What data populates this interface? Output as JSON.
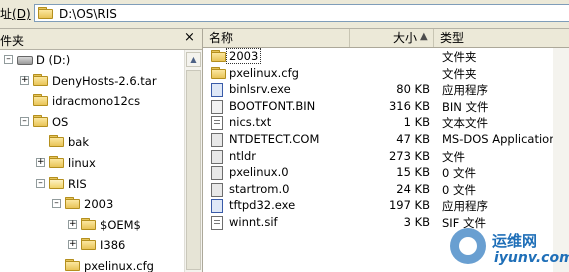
{
  "address": {
    "label_prefix": "址",
    "label_key": "(D)",
    "path": "D:\\OS\\RIS"
  },
  "folders_panel": {
    "title": "件夹",
    "close": "×",
    "tree": [
      {
        "label": "D (D:)",
        "kind": "drive",
        "expander": "−"
      },
      {
        "label": "DenyHosts-2.6.tar",
        "kind": "folder",
        "expander": "+"
      },
      {
        "label": "idracmono12cs",
        "kind": "folder",
        "expander": ""
      },
      {
        "label": "OS",
        "kind": "folder",
        "expander": "−"
      },
      {
        "label": "bak",
        "kind": "folder",
        "expander": ""
      },
      {
        "label": "linux",
        "kind": "folder",
        "expander": "+"
      },
      {
        "label": "RIS",
        "kind": "folder-open",
        "expander": "−"
      },
      {
        "label": "2003",
        "kind": "folder",
        "expander": "−"
      },
      {
        "label": "$OEM$",
        "kind": "folder",
        "expander": "+"
      },
      {
        "label": "I386",
        "kind": "folder",
        "expander": "+"
      },
      {
        "label": "pxelinux.cfg",
        "kind": "folder",
        "expander": ""
      }
    ]
  },
  "columns": {
    "name": "名称",
    "size": "大小",
    "type": "类型",
    "sort_arrow": "▲"
  },
  "files": [
    {
      "name": "2003",
      "size": "",
      "type": "文件夹",
      "icon": "folder-icon",
      "selected": true
    },
    {
      "name": "pxelinux.cfg",
      "size": "",
      "type": "文件夹",
      "icon": "folder-icon"
    },
    {
      "name": "binlsrv.exe",
      "size": "80 KB",
      "type": "应用程序",
      "icon": "exe-icon"
    },
    {
      "name": "BOOTFONT.BIN",
      "size": "316 KB",
      "type": "BIN 文件",
      "icon": "bin-file-icon"
    },
    {
      "name": "nics.txt",
      "size": "1 KB",
      "type": "文本文件",
      "icon": "text-file-icon"
    },
    {
      "name": "NTDETECT.COM",
      "size": "47 KB",
      "type": "MS-DOS Application",
      "icon": "com-file-icon"
    },
    {
      "name": "ntldr",
      "size": "273 KB",
      "type": "文件",
      "icon": "system-file-icon"
    },
    {
      "name": "pxelinux.0",
      "size": "15 KB",
      "type": "0 文件",
      "icon": "system-file-icon"
    },
    {
      "name": "startrom.0",
      "size": "24 KB",
      "type": "0 文件",
      "icon": "system-file-icon"
    },
    {
      "name": "tftpd32.exe",
      "size": "197 KB",
      "type": "应用程序",
      "icon": "tftpd-exe-icon"
    },
    {
      "name": "winnt.sif",
      "size": "3 KB",
      "type": "SIF 文件",
      "icon": "text-file-icon"
    }
  ],
  "watermark": {
    "cn": "运维网",
    "en": "iyunv.com"
  }
}
